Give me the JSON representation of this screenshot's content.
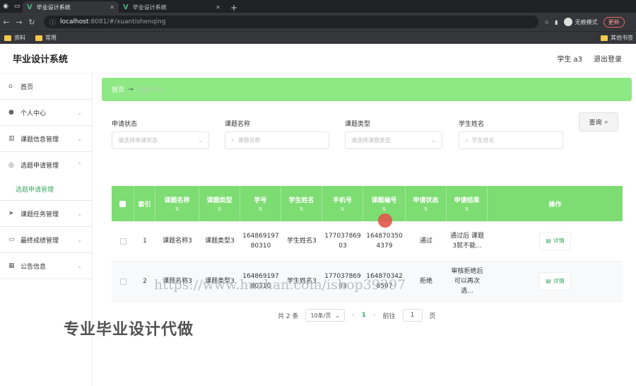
{
  "browser": {
    "tabs": [
      {
        "label": "毕业设计系统",
        "active": true
      },
      {
        "label": "毕业设计系统",
        "active": false
      }
    ],
    "url_host": "localhost",
    "url_rest": ":8081/#/xuantishenqing",
    "incognito_label": "无痕模式",
    "update_label": "更新",
    "bookmarks": [
      "资料",
      "常用"
    ],
    "bookmarks_right": "其他书签"
  },
  "header": {
    "title": "毕业设计系统",
    "user": "学生 a3",
    "logout": "退出登录"
  },
  "sidebar": {
    "items": [
      {
        "label": "首页",
        "icon": "home-icon",
        "has_arrow": false
      },
      {
        "label": "个人中心",
        "icon": "user-icon",
        "has_arrow": true
      },
      {
        "label": "课题信息管理",
        "icon": "book-icon",
        "has_arrow": true
      },
      {
        "label": "选题申请管理",
        "icon": "target-icon",
        "has_arrow": true,
        "expanded": true
      },
      {
        "label": "课题任务管理",
        "icon": "send-icon",
        "has_arrow": true
      },
      {
        "label": "最终成绩管理",
        "icon": "chat-icon",
        "has_arrow": true
      },
      {
        "label": "公告信息",
        "icon": "grid-icon",
        "has_arrow": true
      }
    ],
    "submenu": "选题申请管理"
  },
  "breadcrumb": {
    "home": "首页",
    "sep": "→",
    "current": "选题申请"
  },
  "filters": [
    {
      "label": "申请状态",
      "placeholder": "请选择申请状态",
      "type": "select"
    },
    {
      "label": "课题名称",
      "placeholder": "课题名称",
      "type": "search"
    },
    {
      "label": "课题类型",
      "placeholder": "请选择课题类型",
      "type": "select"
    },
    {
      "label": "学生姓名",
      "placeholder": "学生姓名",
      "type": "search"
    }
  ],
  "query_label": "查询",
  "table": {
    "headers": [
      "索引",
      "课题名称",
      "课题类型",
      "学号",
      "学生姓名",
      "手机号",
      "课题编号",
      "申请状态",
      "申请结果",
      "操作"
    ],
    "rows": [
      {
        "index": "1",
        "name": "课题名称3",
        "type": "课题类型3",
        "sid": "16486919780310",
        "student": "学生姓名3",
        "phone": "17703786903",
        "code": "1648703504379",
        "status": "通过",
        "result": "通过后 课题3就不能...",
        "action": "详情"
      },
      {
        "index": "2",
        "name": "课题名称3",
        "type": "课题类型3",
        "sid": "16486919780310",
        "student": "学生姓名3",
        "phone": "17703786903",
        "code": "1648703428507",
        "status": "拒绝",
        "result": "审核拒绝后 可以再次选...",
        "action": "详情"
      }
    ]
  },
  "pager": {
    "total": "共 2 条",
    "page_size": "10条/页",
    "current": "1",
    "goto": "前往",
    "goto_value": "1",
    "page_suffix": "页"
  },
  "watermarks": {
    "url": "https://www.huzhan.com/ishop39397",
    "slogan": "专业毕业设计代做"
  },
  "colors": {
    "accent_green": "#7ddc72",
    "breadcrumb_green": "#8ee884",
    "active_text_green": "#41a96a"
  }
}
